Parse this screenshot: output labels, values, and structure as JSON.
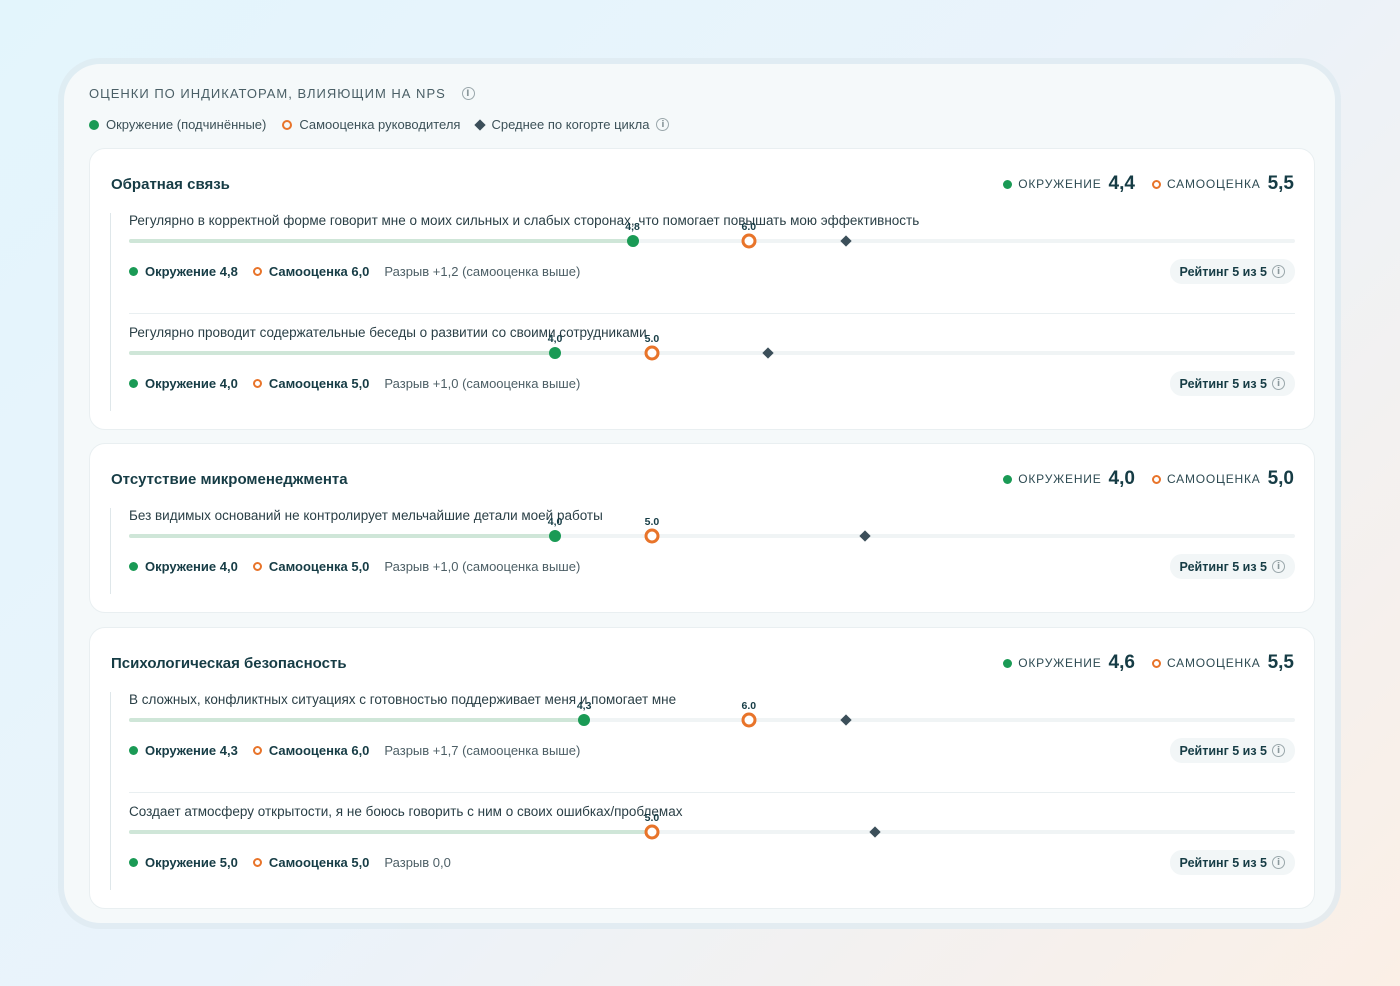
{
  "header": {
    "title": "Оценки по индикаторам, влияющим на NPS",
    "legend": {
      "env": "Окружение (подчинённые)",
      "self": "Самооценка руководителя",
      "avg": "Среднее по когорте цикла"
    }
  },
  "colors": {
    "env": "#1a9a55",
    "self": "#e8742a",
    "avg": "#3c4f5a"
  },
  "summary_labels": {
    "env": "окружение",
    "self": "самооценка"
  },
  "cards": [
    {
      "title": "Обратная связь",
      "env_value": "4,4",
      "self_value": "5,5",
      "items": [
        {
          "text": "Регулярно в корректной форме говорит мне о моих сильных и слабых сторонах, что помогает повышать мою эффективность",
          "env": 4.8,
          "self": 6.0,
          "avg": 7.0,
          "env_label": "4,8",
          "self_label": "6.0",
          "env_text": "Окружение 4,8",
          "self_text": "Самооценка 6,0",
          "gap_text": "Разрыв +1,2 (самооценка выше)",
          "rating": "Рейтинг 5 из 5"
        },
        {
          "text": "Регулярно проводит содержательные беседы о развитии со своими сотрудниками",
          "env": 4.0,
          "self": 5.0,
          "avg": 6.2,
          "env_label": "4,0",
          "self_label": "5.0",
          "env_text": "Окружение 4,0",
          "self_text": "Самооценка 5,0",
          "gap_text": "Разрыв +1,0 (самооценка выше)",
          "rating": "Рейтинг 5 из 5"
        }
      ]
    },
    {
      "title": "Отсутствие микроменеджмента",
      "env_value": "4,0",
      "self_value": "5,0",
      "items": [
        {
          "text": "Без видимых оснований не контролирует мельчайшие детали моей работы",
          "env": 4.0,
          "self": 5.0,
          "avg": 7.2,
          "env_label": "4,0",
          "self_label": "5.0",
          "env_text": "Окружение 4,0",
          "self_text": "Самооценка 5,0",
          "gap_text": "Разрыв +1,0 (самооценка выше)",
          "rating": "Рейтинг 5 из 5"
        }
      ]
    },
    {
      "title": "Психологическая безопасность",
      "env_value": "4,6",
      "self_value": "5,5",
      "items": [
        {
          "text": "В сложных, конфликтных ситуациях с готовностью поддерживает меня и помогает мне",
          "env": 4.3,
          "self": 6.0,
          "avg": 7.0,
          "env_label": "4,3",
          "self_label": "6.0",
          "env_text": "Окружение 4,3",
          "self_text": "Самооценка 6,0",
          "gap_text": "Разрыв +1,7 (самооценка выше)",
          "rating": "Рейтинг 5 из 5"
        },
        {
          "text": "Создает атмосферу открытости, я не боюсь говорить с ним о своих ошибках/проблемах",
          "env": 5.0,
          "self": 5.0,
          "avg": 7.3,
          "env_label": "",
          "self_label": "5.0",
          "env_text": "Окружение 5,0",
          "self_text": "Самооценка 5,0",
          "gap_text": "Разрыв 0,0",
          "rating": "Рейтинг 5 из 5"
        }
      ]
    }
  ]
}
